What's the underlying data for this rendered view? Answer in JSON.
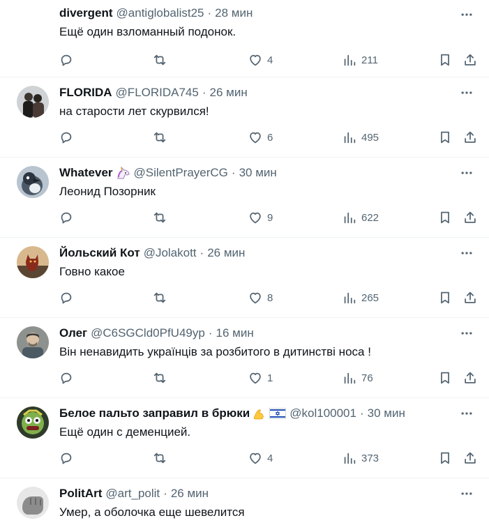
{
  "tweets": [
    {
      "name": "divergent",
      "badge": "",
      "handle": "@antiglobalist25",
      "dot": "·",
      "time": "28 мин",
      "text": "Ещё один взломанный подонок.",
      "replies": "",
      "retweets": "",
      "likes": "4",
      "views": "211",
      "avatar_color": "#ffffff"
    },
    {
      "name": "FLORIDA",
      "badge": "",
      "handle": "@FLORIDA745",
      "dot": "·",
      "time": "26 мин",
      "text": "на старости лет скурвился!",
      "replies": "",
      "retweets": "",
      "likes": "6",
      "views": "495",
      "avatar_color": "#3b3630"
    },
    {
      "name": "Whatever",
      "badge": "unicorn-emoji",
      "handle": "@SilentPrayerCG",
      "dot": "·",
      "time": "30 мин",
      "text": "Леонид Позорник",
      "replies": "",
      "retweets": "",
      "likes": "9",
      "views": "622",
      "avatar_color": "#5d6b7a"
    },
    {
      "name": "Йольский Кот",
      "badge": "",
      "handle": "@Jolakott",
      "dot": "·",
      "time": "26 мин",
      "text": "Говно какое",
      "replies": "",
      "retweets": "",
      "likes": "8",
      "views": "265",
      "avatar_color": "#7a3a2a"
    },
    {
      "name": "Олег",
      "badge": "",
      "handle": "@C6SGCld0PfU49yp",
      "dot": "·",
      "time": "16 мин",
      "text": "Він ненавидить українців за розбитого в дитинстві носа !",
      "replies": "",
      "retweets": "",
      "likes": "1",
      "views": "76",
      "avatar_color": "#6a6f6c"
    },
    {
      "name": "Белое пальто заправил в брюки",
      "badge": "flexed-biceps-emoji israel-flag-emoji",
      "handle": "@kol100001",
      "dot": "·",
      "time": "30 мин",
      "text": "Ещё один с деменцией.",
      "replies": "",
      "retweets": "",
      "likes": "4",
      "views": "373",
      "avatar_color": "#3f7d3a"
    },
    {
      "name": "PolitArt",
      "badge": "",
      "handle": "@art_polit",
      "dot": "·",
      "time": "26 мин",
      "text": "Умер, а оболочка еще шевелится",
      "replies": "",
      "retweets": "",
      "likes": "",
      "views": "",
      "avatar_color": "#9a9a9a"
    }
  ],
  "colors": {
    "text": "#0f1419",
    "secondary": "#536471",
    "divider": "#eff3f4"
  }
}
